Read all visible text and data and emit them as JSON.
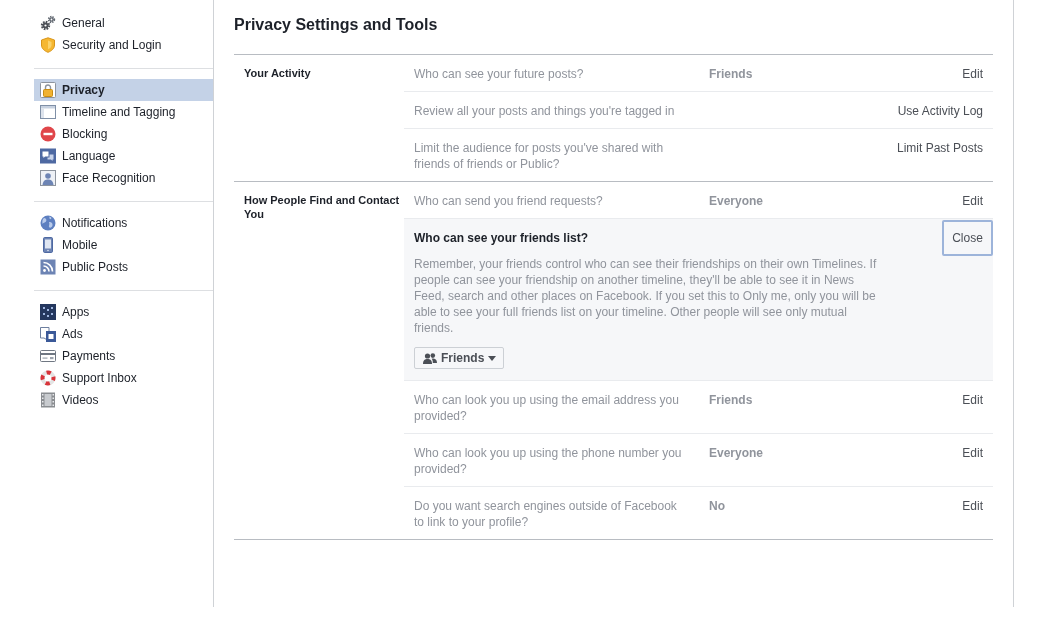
{
  "sidebar": {
    "groups": [
      {
        "items": [
          {
            "label": "General",
            "selected": false
          },
          {
            "label": "Security and Login",
            "selected": false
          }
        ]
      },
      {
        "items": [
          {
            "label": "Privacy",
            "selected": true
          },
          {
            "label": "Timeline and Tagging",
            "selected": false
          },
          {
            "label": "Blocking",
            "selected": false
          },
          {
            "label": "Language",
            "selected": false
          },
          {
            "label": "Face Recognition",
            "selected": false
          }
        ]
      },
      {
        "items": [
          {
            "label": "Notifications",
            "selected": false
          },
          {
            "label": "Mobile",
            "selected": false
          },
          {
            "label": "Public Posts",
            "selected": false
          }
        ]
      },
      {
        "items": [
          {
            "label": "Apps",
            "selected": false
          },
          {
            "label": "Ads",
            "selected": false
          },
          {
            "label": "Payments",
            "selected": false
          },
          {
            "label": "Support Inbox",
            "selected": false
          },
          {
            "label": "Videos",
            "selected": false
          }
        ]
      }
    ]
  },
  "main": {
    "title": "Privacy Settings and Tools",
    "sections": [
      {
        "label": "Your Activity",
        "rows": [
          {
            "kind": "setting",
            "question": "Who can see your future posts?",
            "value": "Friends",
            "action": "Edit"
          },
          {
            "kind": "setting",
            "question": "Review all your posts and things you're tagged in",
            "action": "Use Activity Log"
          },
          {
            "kind": "setting",
            "question": "Limit the audience for posts you've shared with friends of friends or Public?",
            "action": "Limit Past Posts"
          }
        ]
      },
      {
        "label": "How People Find and Contact You",
        "rows": [
          {
            "kind": "setting",
            "question": "Who can send you friend requests?",
            "value": "Everyone",
            "action": "Edit"
          },
          {
            "kind": "expanded",
            "question": "Who can see your friends list?",
            "description": "Remember, your friends control who can see their friendships on their own Timelines. If people can see your friendship on another timeline, they'll be able to see it in News Feed, search and other places on Facebook. If you set this to Only me, only you will be able to see your full friends list on your timeline. Other people will see only mutual friends.",
            "audience": "Friends",
            "action": "Close",
            "focused": true
          },
          {
            "kind": "setting",
            "question": "Who can look you up using the email address you provided?",
            "value": "Friends",
            "action": "Edit"
          },
          {
            "kind": "setting",
            "question": "Who can look you up using the phone number you provided?",
            "value": "Everyone",
            "action": "Edit"
          },
          {
            "kind": "setting",
            "question": "Do you want search engines outside of Facebook to link to your profile?",
            "value": "No",
            "action": "Edit"
          }
        ]
      }
    ]
  }
}
